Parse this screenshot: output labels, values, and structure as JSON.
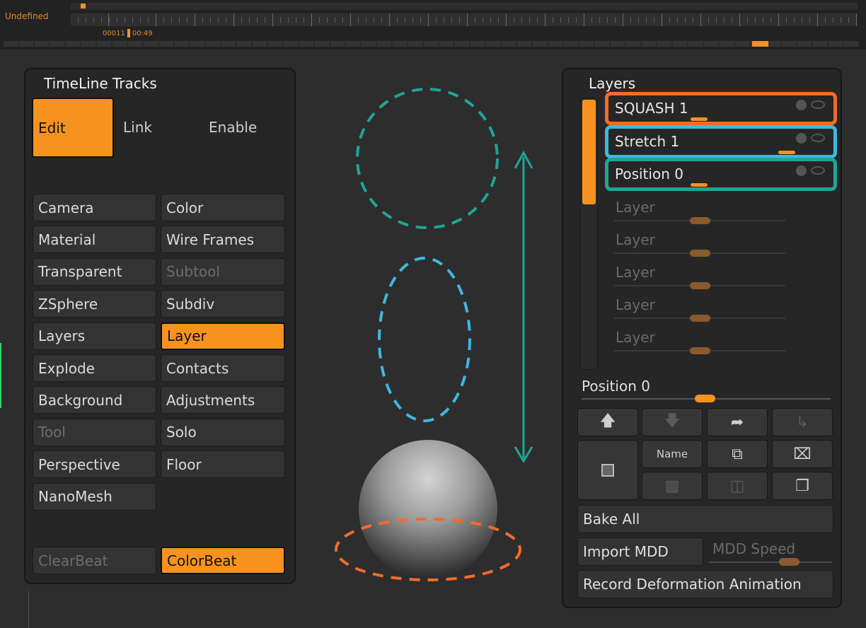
{
  "timeline": {
    "label": "Undefined",
    "frame": "00011",
    "time": "00:49"
  },
  "tracks": {
    "title": "TimeLine Tracks",
    "edit": "Edit",
    "link": "Link",
    "enable": "Enable",
    "grid": [
      {
        "left": {
          "label": "Camera",
          "state": "normal"
        },
        "right": {
          "label": "Color",
          "state": "normal"
        }
      },
      {
        "left": {
          "label": "Material",
          "state": "normal"
        },
        "right": {
          "label": "Wire Frames",
          "state": "normal"
        }
      },
      {
        "left": {
          "label": "Transparent",
          "state": "normal"
        },
        "right": {
          "label": "Subtool",
          "state": "disabled"
        }
      },
      {
        "left": {
          "label": "ZSphere",
          "state": "normal"
        },
        "right": {
          "label": "Subdiv",
          "state": "normal"
        }
      },
      {
        "left": {
          "label": "Layers",
          "state": "normal"
        },
        "right": {
          "label": "Layer",
          "state": "active"
        }
      },
      {
        "left": {
          "label": "Explode",
          "state": "normal"
        },
        "right": {
          "label": "Contacts",
          "state": "normal"
        }
      },
      {
        "left": {
          "label": "Background",
          "state": "normal"
        },
        "right": {
          "label": "Adjustments",
          "state": "normal"
        }
      },
      {
        "left": {
          "label": "Tool",
          "state": "disabled"
        },
        "right": {
          "label": "Solo",
          "state": "normal"
        }
      },
      {
        "left": {
          "label": "Perspective",
          "state": "normal"
        },
        "right": {
          "label": "Floor",
          "state": "normal"
        }
      },
      {
        "left": {
          "label": "NanoMesh",
          "state": "normal"
        }
      }
    ],
    "clear_beat": "ClearBeat",
    "color_beat": "ColorBeat"
  },
  "layers": {
    "title": "Layers",
    "rows": [
      {
        "label": "SQUASH 1",
        "outline_color": "#f26b2a",
        "slider": 0.0
      },
      {
        "label": "Stretch 1",
        "outline_color": "#3fb8e0",
        "slider": 1.0
      },
      {
        "label": "Position 0",
        "outline_color": "#1fa596",
        "slider": 0.0
      }
    ],
    "empty_layers": [
      "Layer",
      "Layer",
      "Layer",
      "Layer",
      "Layer"
    ],
    "position_label": "Position 0",
    "bake_all": "Bake All",
    "import_mdd": "Import MDD",
    "mdd_speed": "MDD Speed",
    "record": "Record Deformation Animation",
    "name_button": "Name"
  },
  "colors": {
    "accent_orange": "#f7921e",
    "teal": "#1fa596",
    "cyan": "#3fb8e0",
    "red_orange": "#f26b2a"
  }
}
